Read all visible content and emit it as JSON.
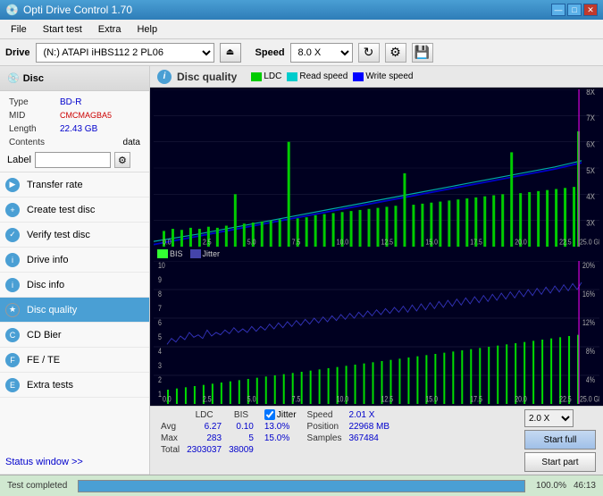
{
  "titleBar": {
    "title": "Opti Drive Control 1.70",
    "minBtn": "—",
    "maxBtn": "□",
    "closeBtn": "✕"
  },
  "menuBar": {
    "items": [
      "File",
      "Start test",
      "Extra",
      "Help"
    ]
  },
  "driveBar": {
    "driveLabel": "Drive",
    "driveValue": "(N:)  ATAPI iHBS112  2 PL06",
    "speedLabel": "Speed",
    "speedValue": "8.0 X"
  },
  "sidebar": {
    "discHeader": "Disc",
    "discInfo": {
      "typeLabel": "Type",
      "typeValue": "BD-R",
      "midLabel": "MID",
      "midValue": "CMCMAGBA5",
      "lengthLabel": "Length",
      "lengthValue": "22.43 GB",
      "contentsLabel": "Contents",
      "contentsValue": "data",
      "labelLabel": "Label"
    },
    "navItems": [
      {
        "id": "transfer-rate",
        "label": "Transfer rate",
        "active": false
      },
      {
        "id": "create-test-disc",
        "label": "Create test disc",
        "active": false
      },
      {
        "id": "verify-test-disc",
        "label": "Verify test disc",
        "active": false
      },
      {
        "id": "drive-info",
        "label": "Drive info",
        "active": false
      },
      {
        "id": "disc-info",
        "label": "Disc info",
        "active": false
      },
      {
        "id": "disc-quality",
        "label": "Disc quality",
        "active": true
      },
      {
        "id": "cd-bier",
        "label": "CD Bier",
        "active": false
      },
      {
        "id": "fe-te",
        "label": "FE / TE",
        "active": false
      },
      {
        "id": "extra-tests",
        "label": "Extra tests",
        "active": false
      }
    ],
    "statusWindow": "Status window >>",
    "statusCompleted": "Test completed"
  },
  "discQuality": {
    "title": "Disc quality",
    "legend": {
      "ldc": {
        "label": "LDC",
        "color": "#00cc00"
      },
      "readSpeed": {
        "label": "Read speed",
        "color": "#00cccc"
      },
      "writeSpeed": {
        "label": "Write speed",
        "color": "#0000ff"
      },
      "bis": {
        "label": "BIS",
        "color": "#00ff00"
      },
      "jitter": {
        "label": "Jitter",
        "color": "#4444ff"
      }
    }
  },
  "stats": {
    "columns": [
      "LDC",
      "BIS"
    ],
    "rows": [
      {
        "label": "Avg",
        "ldc": "6.27",
        "bis": "0.10",
        "jitter": "13.0%"
      },
      {
        "label": "Max",
        "ldc": "283",
        "bis": "5",
        "jitter": "15.0%"
      },
      {
        "label": "Total",
        "ldc": "2303037",
        "bis": "38009",
        "jitter": ""
      }
    ],
    "jitterLabel": "Jitter",
    "speedLabel": "Speed",
    "speedValue": "2.01 X",
    "positionLabel": "Position",
    "positionValue": "22968 MB",
    "samplesLabel": "Samples",
    "samplesValue": "367484",
    "speedSelect": "2.0 X",
    "startFullLabel": "Start full",
    "startPartLabel": "Start part"
  },
  "statusBar": {
    "completedText": "Test completed",
    "progressPercent": 100,
    "progressLabel": "100.0%",
    "timeLabel": "46:13"
  },
  "colors": {
    "accent": "#4a9fd4",
    "ldcGreen": "#00cc00",
    "bisGreen": "#33ff33",
    "readCyan": "#00cccc",
    "writeBlue": "#0000dd",
    "jitterBlue": "#3333cc",
    "chartBg": "#000020",
    "gridLine": "#1a1a3a"
  }
}
